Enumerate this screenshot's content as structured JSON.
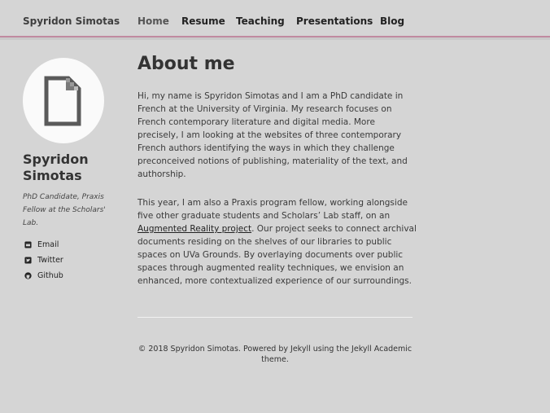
{
  "header": {
    "site_title": "Spyridon Simotas",
    "nav": [
      {
        "label": "Home"
      },
      {
        "label": "Resume"
      },
      {
        "label": "Teaching"
      },
      {
        "label": "Presentations"
      },
      {
        "label": "Blog"
      }
    ],
    "accent_color": "#c08aa0"
  },
  "sidebar": {
    "avatar_icon": "broken-image-icon",
    "name": "Spyridon Simotas",
    "bio": "PhD Candidate, Praxis Fellow at the Scholars' Lab.",
    "links": [
      {
        "label": "Email",
        "icon": "email-icon"
      },
      {
        "label": "Twitter",
        "icon": "twitter-icon"
      },
      {
        "label": "Github",
        "icon": "github-icon"
      }
    ]
  },
  "main": {
    "title": "About me",
    "para1": "Hi, my name is Spyridon Simotas and I am a PhD candidate in French at the University of Virginia. My research focuses on French contemporary literature and digital media. More precisely, I am looking at the websites of three contemporary French authors identifying the ways in which they challenge preconceived notions of publishing, materiality of the text, and authorship.",
    "para2_before": "This year, I am also a Praxis program fellow, working alongside five other graduate students and Scholars’ Lab staff, on an ",
    "para2_link": "Augmented Reality project",
    "para2_after": ". Our project seeks to connect archival documents residing on the shelves of our libraries to public spaces on UVa Grounds. By overlaying documents over public spaces through augmented reality techniques, we envision an enhanced, more contextualized experience of our surroundings."
  },
  "footer": {
    "text": "© 2018 Spyridon Simotas. Powered by Jekyll using the Jekyll Academic theme."
  }
}
